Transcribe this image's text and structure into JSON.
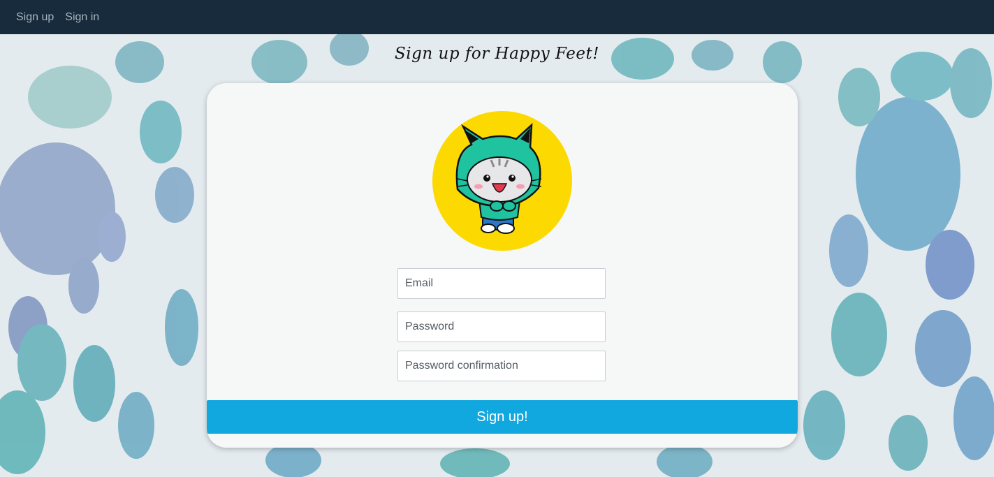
{
  "nav": {
    "links": [
      {
        "label": "Sign up"
      },
      {
        "label": "Sign in"
      }
    ]
  },
  "page": {
    "title": "Sign up for Happy Feet!"
  },
  "form": {
    "email_placeholder": "Email",
    "password_placeholder": "Password",
    "password_confirmation_placeholder": "Password confirmation",
    "submit_label": "Sign up!"
  },
  "colors": {
    "navbar": "#172b3c",
    "nav_link": "#aab4bd",
    "card_bg": "#f6f7f7",
    "avatar_bg": "#fcd900",
    "submit_button": "#10a8df"
  },
  "images": {
    "background": "watercolor-paw-print-pattern",
    "avatar": "cat-mascot-in-green-hoodie"
  }
}
